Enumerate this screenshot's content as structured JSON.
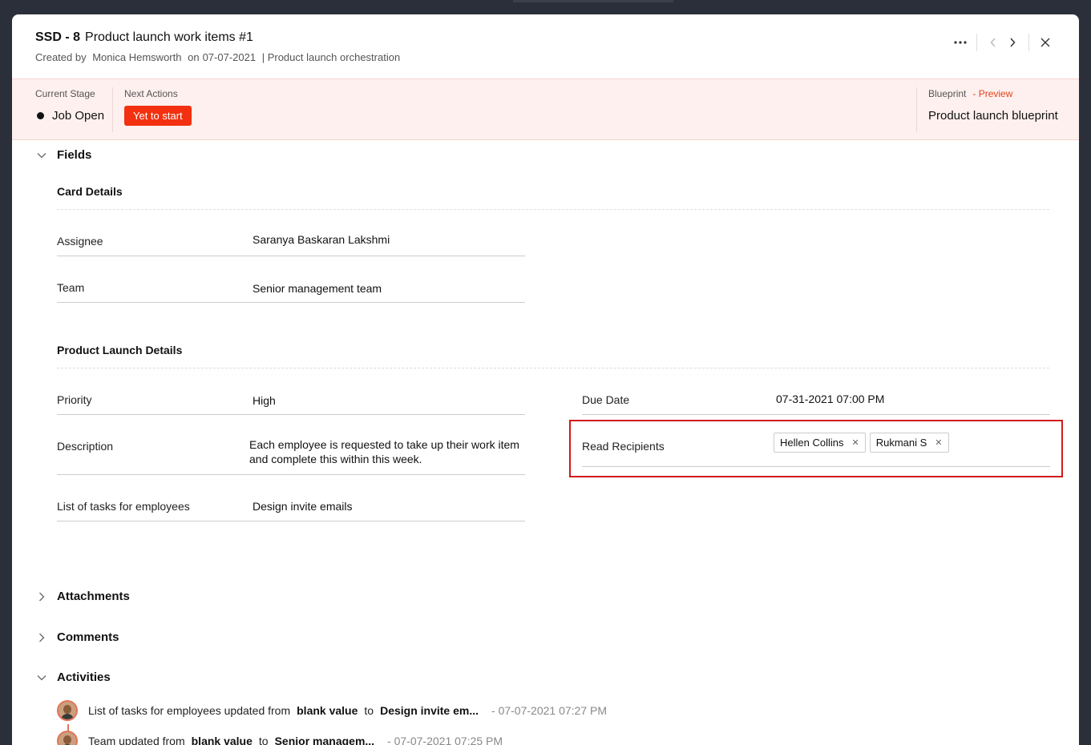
{
  "header": {
    "id": "SSD - 8",
    "title": "Product launch work items #1",
    "created_by_prefix": "Created by",
    "creator": "Monica Hemsworth",
    "on_prefix": "on",
    "created_date": "07-07-2021",
    "orchestration": "| Product launch orchestration"
  },
  "stage": {
    "current_label": "Current Stage",
    "current_value": "Job Open",
    "next_label": "Next Actions",
    "next_button": "Yet to start",
    "blueprint_label": "Blueprint",
    "blueprint_preview": "- Preview",
    "blueprint_value": "Product launch blueprint"
  },
  "sections": {
    "fields": "Fields",
    "attachments": "Attachments",
    "comments": "Comments",
    "activities": "Activities"
  },
  "card_details": {
    "title": "Card Details",
    "assignee_label": "Assignee",
    "assignee_value": "Saranya Baskaran Lakshmi",
    "team_label": "Team",
    "team_value": "Senior management team"
  },
  "product_launch": {
    "title": "Product Launch Details",
    "priority_label": "Priority",
    "priority_value": "High",
    "description_label": "Description",
    "description_value": "Each employee is requested to take up their work item and complete this within this week.",
    "tasks_label": "List of tasks for employees",
    "tasks_value": "Design invite emails",
    "due_label": "Due Date",
    "due_value": "07-31-2021 07:00 PM",
    "recipients_label": "Read Recipients",
    "recipients": [
      "Hellen Collins",
      "Rukmani S"
    ]
  },
  "activities": [
    {
      "text": "List of tasks for employees updated from",
      "from": "blank value",
      "to_word": "to",
      "to": "Design invite em...",
      "time": "- 07-07-2021 07:27 PM"
    },
    {
      "text": "Team updated from",
      "from": "blank value",
      "to_word": "to",
      "to": "Senior managem...",
      "time": "- 07-07-2021 07:25 PM"
    }
  ],
  "colors": {
    "accent": "#f3300f",
    "highlight_border": "#d11a1a",
    "band_bg": "#fdf0ee"
  },
  "icons": [
    "more-icon",
    "prev-icon",
    "next-icon",
    "close-icon",
    "chevron-down-icon",
    "chevron-right-icon",
    "avatar"
  ]
}
